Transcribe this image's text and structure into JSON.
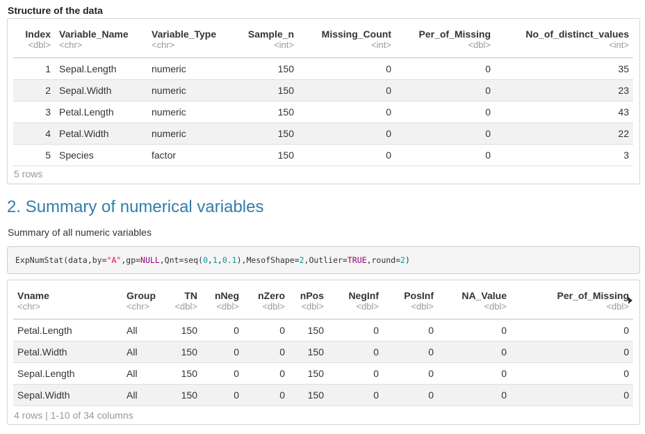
{
  "structure": {
    "title": "Structure of the data",
    "columns": [
      {
        "name": "Index",
        "type": "<dbl>"
      },
      {
        "name": "Variable_Name",
        "type": "<chr>"
      },
      {
        "name": "Variable_Type",
        "type": "<chr>"
      },
      {
        "name": "Sample_n",
        "type": "<int>"
      },
      {
        "name": "Missing_Count",
        "type": "<int>"
      },
      {
        "name": "Per_of_Missing",
        "type": "<dbl>"
      },
      {
        "name": "No_of_distinct_values",
        "type": "<int>"
      }
    ],
    "rows": [
      [
        "1",
        "Sepal.Length",
        "numeric",
        "150",
        "0",
        "0",
        "35"
      ],
      [
        "2",
        "Sepal.Width",
        "numeric",
        "150",
        "0",
        "0",
        "23"
      ],
      [
        "3",
        "Petal.Length",
        "numeric",
        "150",
        "0",
        "0",
        "43"
      ],
      [
        "4",
        "Petal.Width",
        "numeric",
        "150",
        "0",
        "0",
        "22"
      ],
      [
        "5",
        "Species",
        "factor",
        "150",
        "0",
        "0",
        "3"
      ]
    ],
    "footer": "5 rows"
  },
  "section": {
    "heading": "2. Summary of numerical variables",
    "subtitle": "Summary of all numeric variables"
  },
  "code": {
    "parts": [
      "ExpNumStat(data,by=",
      "\"A\"",
      ",gp=",
      "NULL",
      ",Qnt=seq(",
      "0",
      ",",
      "1",
      ",",
      "0.1",
      "),MesofShape=",
      "2",
      ",Outlier=",
      "TRUE",
      ",round=",
      "2",
      ")"
    ]
  },
  "summary": {
    "columns": [
      {
        "name": "Vname",
        "type": "<chr>"
      },
      {
        "name": "Group",
        "type": "<chr>"
      },
      {
        "name": "TN",
        "type": "<dbl>"
      },
      {
        "name": "nNeg",
        "type": "<dbl>"
      },
      {
        "name": "nZero",
        "type": "<dbl>"
      },
      {
        "name": "nPos",
        "type": "<dbl>"
      },
      {
        "name": "NegInf",
        "type": "<dbl>"
      },
      {
        "name": "PosInf",
        "type": "<dbl>"
      },
      {
        "name": "NA_Value",
        "type": "<dbl>"
      },
      {
        "name": "Per_of_Missing",
        "type": "<dbl>"
      }
    ],
    "rows": [
      [
        "Petal.Length",
        "All",
        "150",
        "0",
        "0",
        "150",
        "0",
        "0",
        "0",
        "0"
      ],
      [
        "Petal.Width",
        "All",
        "150",
        "0",
        "0",
        "150",
        "0",
        "0",
        "0",
        "0"
      ],
      [
        "Sepal.Length",
        "All",
        "150",
        "0",
        "0",
        "150",
        "0",
        "0",
        "0",
        "0"
      ],
      [
        "Sepal.Width",
        "All",
        "150",
        "0",
        "0",
        "150",
        "0",
        "0",
        "0",
        "0"
      ]
    ],
    "footer": "4 rows | 1-10 of 34 columns",
    "next_icon": "caret-right-icon"
  }
}
